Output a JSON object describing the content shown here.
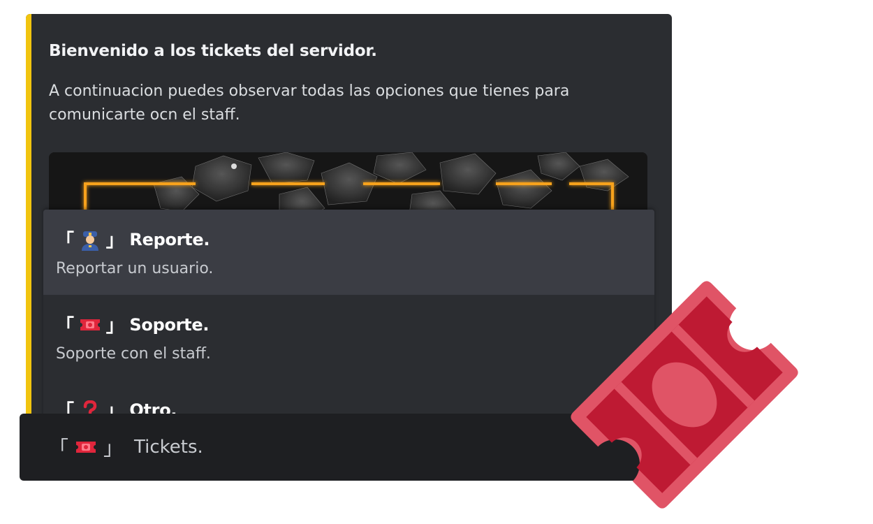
{
  "embed": {
    "title": "Bienvenido a los tickets del servidor.",
    "description": "A continuacion puedes observar todas las opciones que tienes para comunicarte ocn el staff.",
    "accent_color": "#f1c40f"
  },
  "menu": {
    "options": [
      {
        "open": "「",
        "emoji": "police-officer-icon",
        "label": "Reporte.",
        "close": "」",
        "description": "Reportar un usuario."
      },
      {
        "open": "「",
        "emoji": "ticket-icon",
        "label": "Soporte.",
        "close": "」",
        "description": "Soporte con el staff."
      },
      {
        "open": "「",
        "emoji": "question-mark-icon",
        "label": "Otro.",
        "close": "」",
        "description": ""
      }
    ]
  },
  "select": {
    "open": "「",
    "emoji": "ticket-icon",
    "close": "」",
    "placeholder": "Tickets."
  },
  "decoration": {
    "icon": "ticket-icon",
    "color": "#e05466"
  }
}
